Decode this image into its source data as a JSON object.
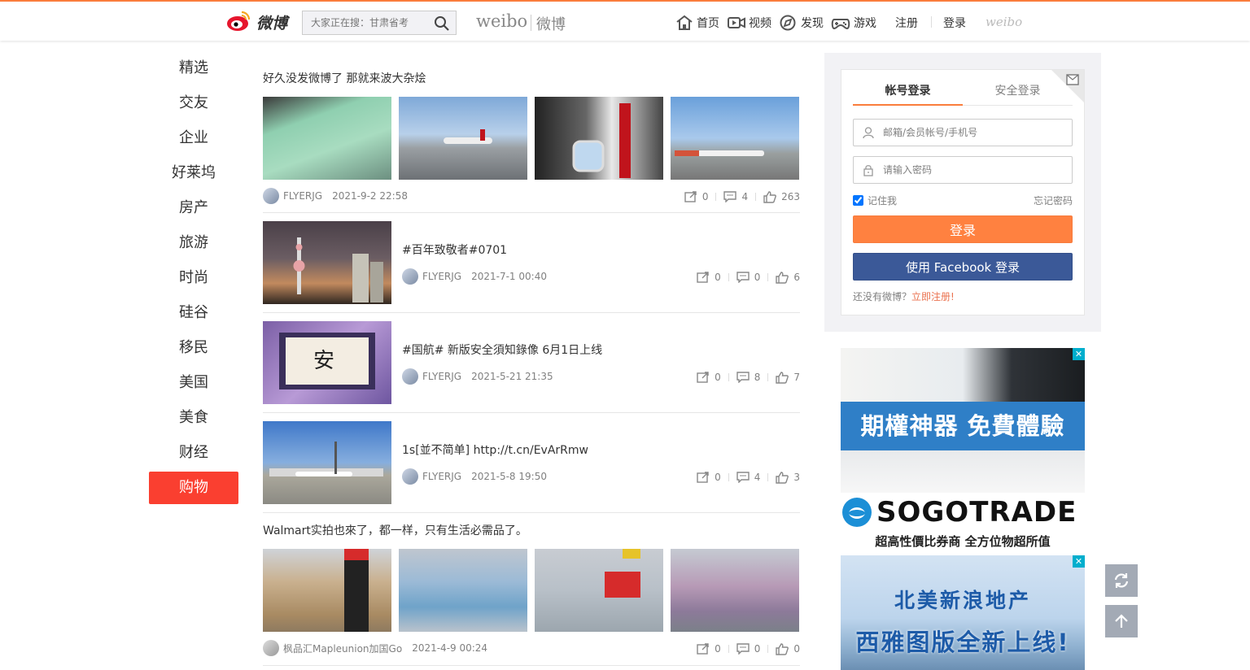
{
  "header": {
    "logo_text": "微博",
    "search_placeholder": "大家正在搜：甘肃省考",
    "brand_en": "weibo",
    "brand_cn": "微博",
    "nav": [
      {
        "label": "首页",
        "icon": "home-icon"
      },
      {
        "label": "视频",
        "icon": "video-icon"
      },
      {
        "label": "发现",
        "icon": "discover-icon"
      },
      {
        "label": "游戏",
        "icon": "game-icon"
      }
    ],
    "register": "注册",
    "login": "登录",
    "weibo_mark": "weibo"
  },
  "sidebar": {
    "items": [
      "精选",
      "交友",
      "企业",
      "好莱坞",
      "房产",
      "旅游",
      "时尚",
      "硅谷",
      "移民",
      "美国",
      "美食",
      "财经",
      "购物"
    ],
    "active_index": 12
  },
  "posts": [
    {
      "title": "好久没发微博了 那就来波大杂烩",
      "author": "FLYERJG",
      "time": "2021-9-2 22:58",
      "forward": "0",
      "comment": "4",
      "like": "263"
    },
    {
      "title": "#百年致敬者#0701",
      "author": "FLYERJG",
      "time": "2021-7-1 00:40",
      "forward": "0",
      "comment": "0",
      "like": "6"
    },
    {
      "title": "#国航# 新版安全須知錄像 6月1日上线",
      "author": "FLYERJG",
      "time": "2021-5-21 21:35",
      "forward": "0",
      "comment": "8",
      "like": "7"
    },
    {
      "title": "1s[並不简单] http://t.cn/EvArRmw",
      "author": "FLYERJG",
      "time": "2021-5-8 19:50",
      "forward": "0",
      "comment": "4",
      "like": "3"
    },
    {
      "title": "Walmart实拍也來了，都一样，只有生活必需品了。",
      "author": "枫品汇Mapleunion加国Go",
      "time": "2021-4-9 00:24",
      "forward": "0",
      "comment": "0",
      "like": "0"
    }
  ],
  "login": {
    "tab_account": "帐号登录",
    "tab_secure": "安全登录",
    "username_placeholder": "邮箱/会员帐号/手机号",
    "password_placeholder": "请输入密码",
    "remember": "记住我",
    "forgot": "忘记密码",
    "login_button": "登录",
    "facebook_button": "使用 Facebook 登录",
    "no_account": "还没有微博？",
    "register_link": "立即注册!"
  },
  "ads": {
    "ad1_headline": "期權神器  免費體驗",
    "ad1_brand": "SOGOTRADE",
    "ad1_tagline": "超高性價比券商  全方位物超所值",
    "ad2_line1": "北美新浪地产",
    "ad2_line2": "西雅图版全新上线!"
  },
  "colors": {
    "accent": "#fa7d3c",
    "sidebar_active": "#fa3f30",
    "facebook": "#3b5998",
    "login_button": "#ff8140"
  }
}
